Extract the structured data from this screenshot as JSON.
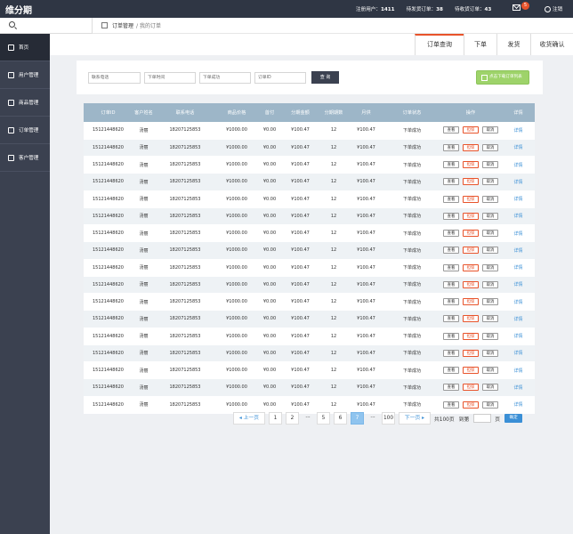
{
  "app": {
    "logo": "维分期"
  },
  "topbar": {
    "stats": [
      {
        "label": "注册用户：",
        "value": "1411"
      },
      {
        "label": "待发货订单：",
        "value": "38"
      },
      {
        "label": "待收货订单：",
        "value": "43"
      }
    ],
    "mail_badge": "5",
    "logout": "注销"
  },
  "breadcrumb": {
    "section": "订单管理",
    "page": "/ 我的订单"
  },
  "sidebar": {
    "items": [
      {
        "label": "首页",
        "icon": "home-icon"
      },
      {
        "label": "用户管理",
        "icon": "user-icon"
      },
      {
        "label": "商品管理",
        "icon": "goods-icon"
      },
      {
        "label": "订单管理",
        "icon": "order-icon"
      },
      {
        "label": "客户管理",
        "icon": "customer-icon"
      }
    ]
  },
  "tabs": [
    "订单查询",
    "下单",
    "发货",
    "收货确认"
  ],
  "filters": [
    "联系电话",
    "下单时间",
    "下单成功",
    "订单ID"
  ],
  "query_button": "查 询",
  "export_button": "点击下载订单列表",
  "table": {
    "headers": [
      "订单ID",
      "客户姓名",
      "联系电话",
      "商品价格",
      "首付",
      "分期金额",
      "分期期数",
      "月供",
      "订单状态",
      "操作",
      "详情"
    ],
    "row": {
      "id": "15121448620",
      "name": "汤丽",
      "phone": "18207125853",
      "price": "¥1000.00",
      "down": "¥0.00",
      "amount": "¥100.47",
      "periods": "12",
      "monthly": "¥100.47",
      "status": "下单成功",
      "view": "查看",
      "guarantee": "担保",
      "cancel": "取消",
      "detail": "详情"
    },
    "row_count": 17
  },
  "pager": {
    "prev": "◂ 上一页",
    "pages": [
      "1",
      "2",
      "5",
      "6",
      "7",
      "100"
    ],
    "current": "7",
    "next": "下一页 ▸",
    "total": "共100页",
    "goto": "到第",
    "page_unit": "页",
    "ok": "确定",
    "ellipsis": "···"
  },
  "colors": {
    "accent": "#e8532b",
    "sidebar": "#3b4150",
    "header_row": "#9db6c8",
    "link": "#3a8fd6"
  }
}
